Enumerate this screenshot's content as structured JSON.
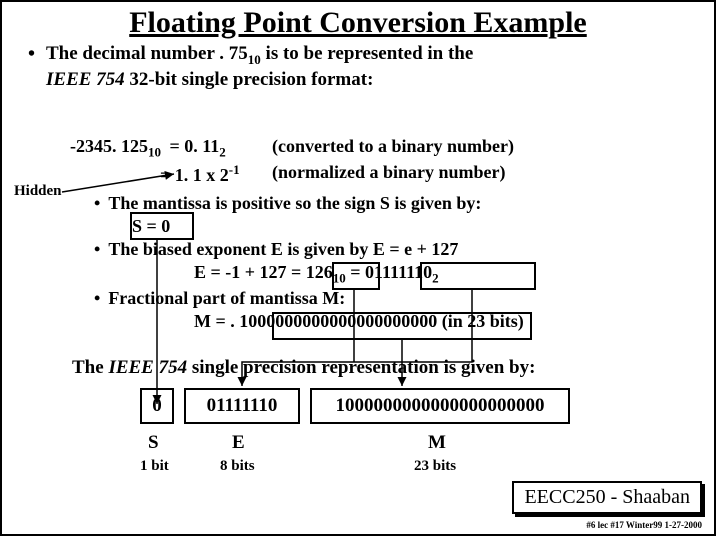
{
  "title": "Floating Point Conversion Example",
  "intro": {
    "part1": "The decimal number  . 75",
    "sub1": "10",
    "part2": "  is to be represented in the ",
    "part3": "IEEE 754",
    "part4": "  32-bit single precision format:"
  },
  "example": {
    "src": "-2345. 125",
    "srcSub": "10",
    "eq1a": "=  0. 11",
    "eq1aSub": "2",
    "note1": "(converted to a binary number)",
    "eq2": "=  1. 1 x 2",
    "eq2sup": "-1",
    "note2": "(normalized a binary number)"
  },
  "hidden": "Hidden",
  "bul": {
    "b1": "The mantissa is positive so the sign  S is given by:",
    "s0": "S = 0",
    "b2": "The biased exponent E is given by   E =  e  + 127",
    "ecalc": "E = -1 + 127  =  126",
    "ecalcSub": "10",
    "eqsep": "  =  ",
    "ebin": "01111110",
    "ebinSub": "2",
    "b3": "Fractional part of mantissa  M:",
    "mcalc": "M =  . 1000000000000000000000",
    "mbits": " (in 23 bits)"
  },
  "final": "The ",
  "finalIeee": "IEEE 754",
  "final2": " single precision representation is given by:",
  "enc": {
    "sign": "0",
    "exp": "01111110",
    "mant": "1000000000000000000000"
  },
  "labels": {
    "s": "S",
    "e": "E",
    "m": "M"
  },
  "bits": {
    "s": "1 bit",
    "e": "8 bits",
    "m": "23 bits"
  },
  "course": "EECC250 - Shaaban",
  "tiny": "#6  lec #17   Winter99   1-27-2000"
}
